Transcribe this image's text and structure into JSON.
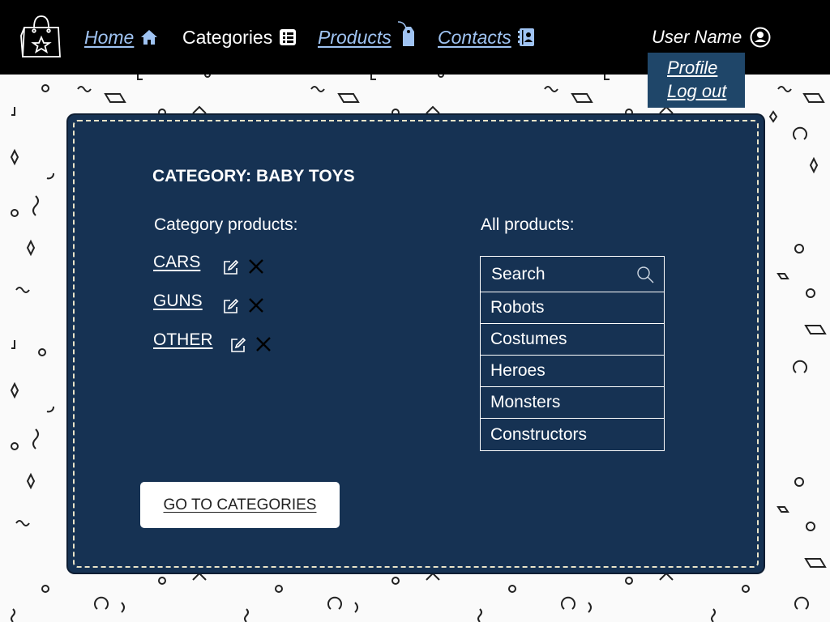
{
  "header": {
    "nav": [
      {
        "label": "Home",
        "icon": "home-icon"
      },
      {
        "label": "Categories",
        "icon": "list-icon"
      },
      {
        "label": "Products",
        "icon": "tag-icon"
      },
      {
        "label": "Contacts",
        "icon": "address-book-icon"
      }
    ],
    "user": {
      "name": "User Name",
      "icon": "user-icon"
    },
    "user_menu": [
      "Profile",
      "Log out"
    ]
  },
  "category": {
    "title": "CATEGORY: BABY TOYS",
    "section_label": "Category products:",
    "items": [
      "CARS",
      "GUNS",
      "OTHER"
    ]
  },
  "all_products": {
    "section_label": "All products:",
    "search_placeholder": "Search",
    "items": [
      "Robots",
      "Costumes",
      "Heroes",
      "Monsters",
      "Constructors"
    ]
  },
  "actions": {
    "go_to_categories": "GO TO CATEGORIES"
  },
  "colors": {
    "header_bg": "#000000",
    "link": "#9fc3f2",
    "panel_bg": "#163253",
    "menu_bg": "#1f4669"
  }
}
